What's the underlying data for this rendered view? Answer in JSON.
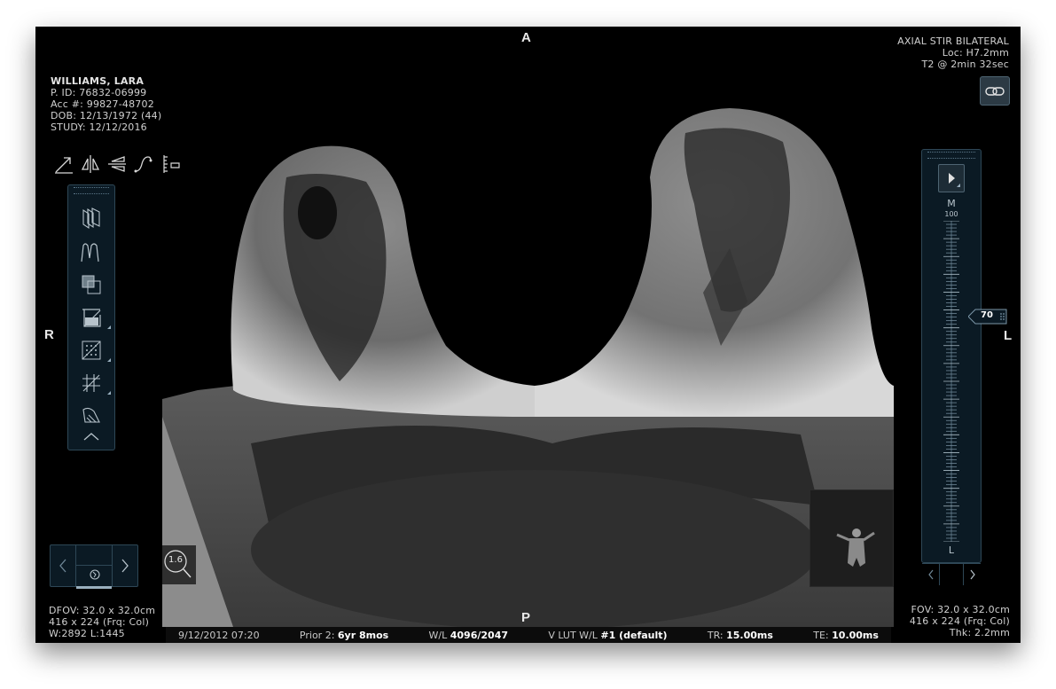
{
  "patient": {
    "name": "WILLIAMS, LARA",
    "pid": "P. ID: 76832-06999",
    "acc": "Acc #: 99827-48702",
    "dob": "DOB: 12/13/1972 (44)",
    "study": "STUDY: 12/12/2016"
  },
  "series": {
    "title": "AXIAL STIR BILATERAL",
    "loc": "Loc: H7.2mm",
    "time": "T2 @ 2min 32sec"
  },
  "orientation": {
    "top": "A",
    "bottom": "P",
    "left": "R",
    "right": "L"
  },
  "left_info": {
    "dfov": "DFOV: 32.0 x 32.0cm",
    "matrix": "416 x 224 (Frq: Col)",
    "wl": "W:2892 L:1445"
  },
  "right_info": {
    "fov": "FOV: 32.0 x 32.0cm",
    "matrix": "416 x 224 (Frq: Col)",
    "thk": "Thk: 2.2mm"
  },
  "status_bar": {
    "date": "9/12/2012 07:20",
    "prior_label": "Prior 2:",
    "prior_value": "6yr 8mos",
    "wl_label": "W/L",
    "wl_value": "4096/2047",
    "vlut_label": "V LUT W/L",
    "vlut_value": "#1 (default)",
    "tr_label": "TR:",
    "tr_value": "15.00ms",
    "te_label": "TE:",
    "te_value": "10.00ms"
  },
  "zoom": {
    "value": "1.6"
  },
  "slice_slider": {
    "top_label": "M",
    "top_value": "100",
    "bottom_label": "L",
    "value": "70",
    "level": 0.7
  },
  "icons": {
    "tools_row": [
      "arrow-icon",
      "flip-horizontal-icon",
      "flip-vertical-icon",
      "curve-icon",
      "ruler-icon"
    ],
    "toolbar": [
      "stack-icon",
      "wave-icon",
      "overlay-icon",
      "crop-icon",
      "pattern-icon",
      "grid-icon",
      "annotate-icon",
      "chevron-up-icon"
    ]
  },
  "colors": {
    "panel_bg": "#0b1a24",
    "panel_border": "#2e4756",
    "accent": "#9ab0bf"
  }
}
